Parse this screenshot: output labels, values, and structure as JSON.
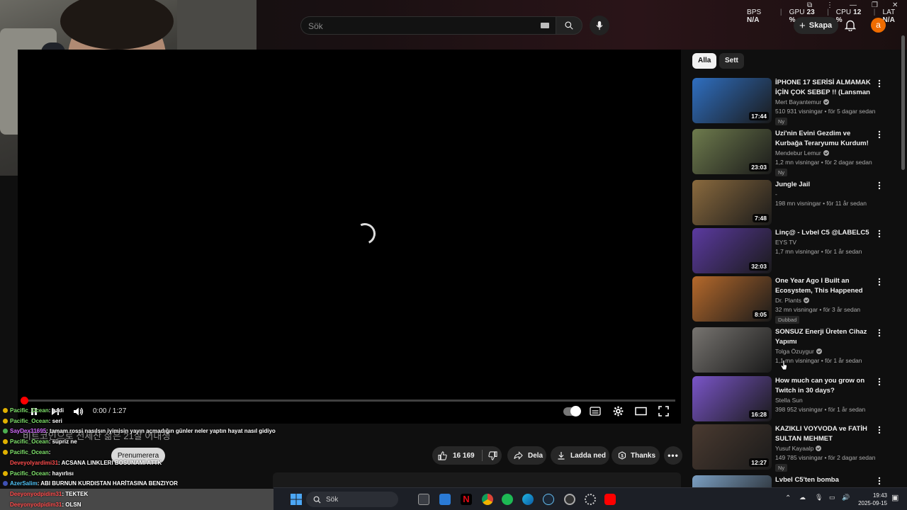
{
  "stats": {
    "bps_label": "BPS",
    "bps_value": "N/A",
    "gpu_label": "GPU",
    "gpu_value": "23 %",
    "cpu_label": "CPU",
    "cpu_value": "12 %",
    "lat_label": "LAT",
    "lat_value": "N/A"
  },
  "header": {
    "search_placeholder": "Sök",
    "create_label": "Skapa",
    "avatar_letter": "a"
  },
  "player": {
    "time": "0:00 / 1:27",
    "progress": 0.0
  },
  "below_player": {
    "subtitle_ghost": "비트코인으로 전세산 삶은 21살 어대생",
    "subscribe_label": "Prenumerera",
    "likes": "16 169",
    "share_label": "Dela",
    "download_label": "Ladda ned",
    "thanks_label": "Thanks"
  },
  "chat": [
    {
      "user": "Pacific_Ocean",
      "msg": ": hadi",
      "color": "#7fe36b",
      "dot": "#e0b000"
    },
    {
      "user": "Pacific_Ocean",
      "msg": ": seri",
      "color": "#7fe36b",
      "dot": "#e0b000"
    },
    {
      "user": "SayDex31695",
      "msg": ": tamam rossi nasılsın iyimisin yayın açmadığın günler neler yaptın hayat nasıl gidiyo",
      "color": "#d36bff",
      "dot": "#4caf50"
    },
    {
      "user": "Pacific_Ocean",
      "msg": ": süpriz ne",
      "color": "#7fe36b",
      "dot": "#e0b000"
    },
    {
      "user": "Pacific_Ocean",
      "msg": ": ",
      "color": "#7fe36b",
      "dot": "#e0b000"
    },
    {
      "user": "Deveyolyardimi31",
      "msg": ": ACSANA LINKLERI BOSUNAMI ATTK",
      "color": "#ff4c4c",
      "dot": ""
    },
    {
      "user": "Pacific_Ocean",
      "msg": ": hayırlısı",
      "color": "#7fe36b",
      "dot": "#e0b000"
    },
    {
      "user": "AzerSalim",
      "msg": ": ABI BURNUN KURDISTAN HARİTASINA BENZIYOR",
      "color": "#4fc3f7",
      "dot": "#3f51b5"
    },
    {
      "user": "Deeyonyodpidim31",
      "msg": ": TEKTEK",
      "color": "#ff4c4c",
      "dot": "",
      "boxed": true
    },
    {
      "user": "Deeyonyodpidim31",
      "msg": ": OLSN",
      "color": "#ff4c4c",
      "dot": "",
      "boxed": true
    }
  ],
  "sidebar": {
    "chips": [
      "Alla",
      "Sett"
    ],
    "recommendations": [
      {
        "title": "İPHONE 17 SERİSİ ALMAMAK İÇİN ÇOK SEBEP !! (Lansman ...",
        "channel": "Mert Bayantemur",
        "verified": true,
        "meta": "510 931 visningar • för 5 dagar sedan",
        "badge": "Ny",
        "duration": "17:44",
        "thumb": "#2f6fc1"
      },
      {
        "title": "Uzi'nin Evini Gezdim ve Kurbağa Teraryumu Kurdum! ...",
        "channel": "Mendebur Lemur",
        "verified": true,
        "meta": "1,2 mn visningar • för 2 dagar sedan",
        "badge": "Ny",
        "duration": "23:03",
        "thumb": "#6e7b4d"
      },
      {
        "title": "Jungle Jail",
        "channel": "-",
        "verified": false,
        "meta": "198 mn visningar • för 11 år sedan",
        "badge": "",
        "duration": "7:48",
        "thumb": "#8a6a3e"
      },
      {
        "title": "Linç@ - Lvbel C5 @LABELC5",
        "channel": "EYS TV",
        "verified": false,
        "meta": "1,7 mn visningar • för 1 år sedan",
        "badge": "",
        "duration": "32:03",
        "thumb": "#5b3aa0"
      },
      {
        "title": "One Year Ago I Built an Ecosystem, This Happened",
        "channel": "Dr. Plants",
        "verified": true,
        "meta": "32 mn visningar • för 3 år sedan",
        "badge": "Dubbad",
        "duration": "8:05",
        "thumb": "#b5692b"
      },
      {
        "title": "SONSUZ Enerji Üreten Cihaz Yapımı",
        "channel": "Tolga Özuygur",
        "verified": true,
        "meta": "1,1 mn visningar • för 1 år sedan",
        "badge": "",
        "duration": "",
        "thumb": "#777470"
      },
      {
        "title": "How much can you grow on Twitch in 30 days?",
        "channel": "Stella Sun",
        "verified": false,
        "meta": "398 952 visningar • för 1 år sedan",
        "badge": "",
        "duration": "16:28",
        "thumb": "#7a55c9"
      },
      {
        "title": "KAZIKLI VOYVODA ve FATİH SULTAN MEHMET",
        "channel": "Yusuf Kayaalp",
        "verified": true,
        "meta": "149 785 visningar • för 2 dagar sedan",
        "badge": "Ny",
        "duration": "12:27",
        "thumb": "#4a3a30"
      },
      {
        "title": "Lvbel C5'ten bomba",
        "channel": "",
        "verified": false,
        "meta": "",
        "badge": "",
        "duration": "",
        "thumb": "#7b9fc2"
      }
    ]
  },
  "taskbar": {
    "search_label": "Sök",
    "time": "19:43",
    "date": "2025-09-15"
  }
}
